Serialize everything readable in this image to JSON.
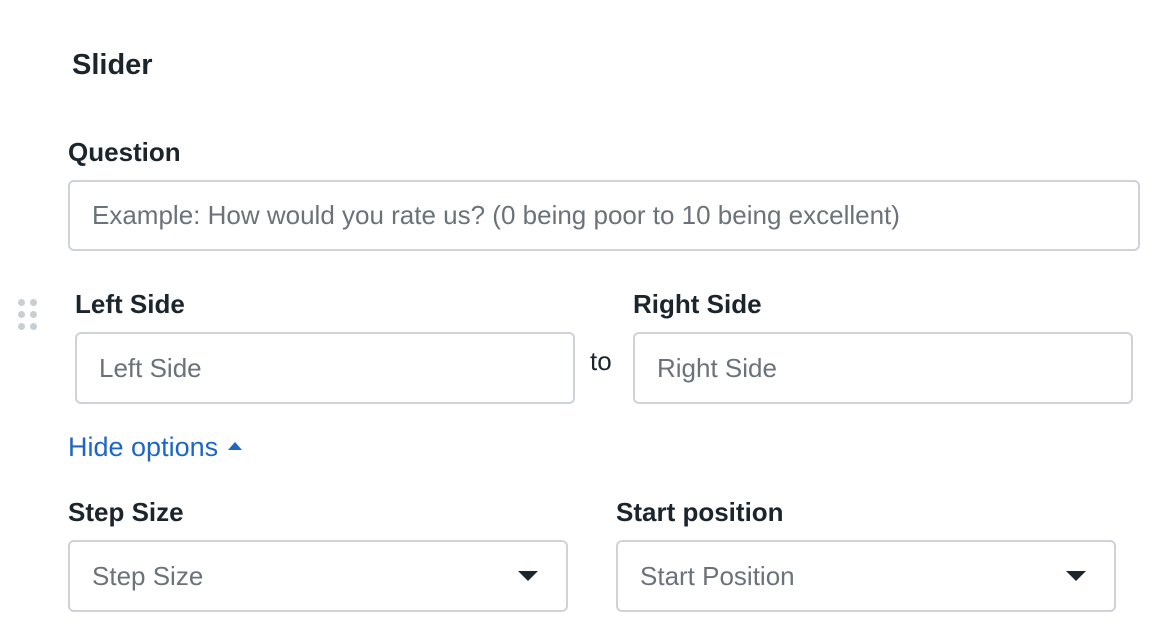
{
  "section": {
    "title": "Slider"
  },
  "question": {
    "label": "Question",
    "placeholder": "Example: How would you rate us? (0 being poor to 10 being excellent)",
    "value": ""
  },
  "range": {
    "left_label": "Left Side",
    "left_placeholder": "Left Side",
    "connector": "to",
    "right_label": "Right Side",
    "right_placeholder": "Right Side"
  },
  "options_toggle": {
    "label": "Hide options",
    "icon": "caret-up-icon",
    "color": "#1f66c4"
  },
  "step_size": {
    "label": "Step Size",
    "selected": "Step Size",
    "icon": "caret-down-icon"
  },
  "start_position": {
    "label": "Start position",
    "selected": "Start Position",
    "icon": "caret-down-icon"
  },
  "drag_handle": {
    "icon": "drag-handle-icon"
  }
}
